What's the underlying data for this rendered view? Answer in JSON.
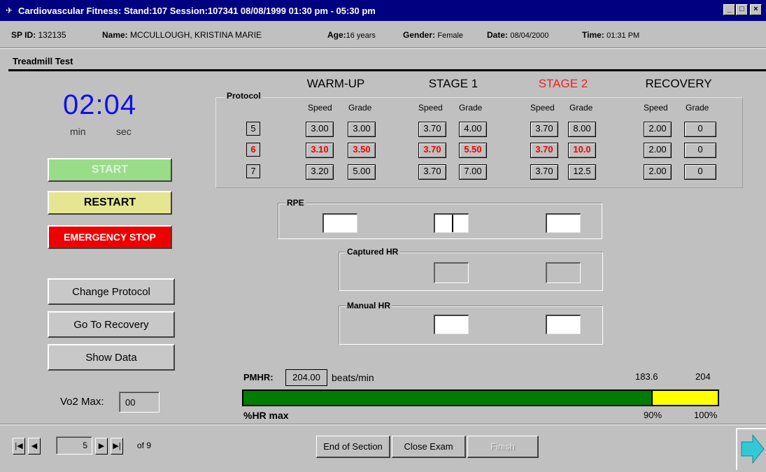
{
  "window": {
    "title": "Cardiovascular Fitness: Stand:107 Session:107341 08/08/1999 01:30 pm - 05:30 pm",
    "controls": [
      "_",
      "□",
      "×"
    ]
  },
  "info": {
    "spid_label": "SP ID:",
    "spid_value": "132135",
    "name_label": "Name:",
    "name_value": "MCCULLOUGH, KRISTINA MARIE",
    "age_label": "Age:",
    "age_value": "16 years",
    "gender_label": "Gender:",
    "gender_value": "Female",
    "date_label": "Date:",
    "date_value": "08/04/2000",
    "time_label": "Time:",
    "time_value": "01:31 PM"
  },
  "section_title": "Treadmill Test",
  "timer": {
    "display": "02:04",
    "min_label": "min",
    "sec_label": "sec"
  },
  "buttons": {
    "start": "START",
    "restart": "RESTART",
    "emergency": "EMERGENCY STOP",
    "change_protocol": "Change Protocol",
    "go_to_recovery": "Go To Recovery",
    "show_data": "Show Data"
  },
  "vo2": {
    "label": "Vo2 Max:",
    "value": "00"
  },
  "protocol": {
    "label": "Protocol",
    "stages": [
      "WARM-UP",
      "STAGE 1",
      "STAGE 2",
      "RECOVERY"
    ],
    "current_stage_color": "#ee2222",
    "speed_label": "Speed",
    "grade_label": "Grade",
    "rows": [
      {
        "id": "5",
        "values": [
          "3.00",
          "3.00",
          "3.70",
          "4.00",
          "3.70",
          "8.00",
          "2.00",
          "0"
        ]
      },
      {
        "id": "6",
        "values": [
          "3.10",
          "3.50",
          "3.70",
          "5.50",
          "3.70",
          "10.0",
          "2.00",
          "0"
        ]
      },
      {
        "id": "7",
        "values": [
          "3.20",
          "5.00",
          "3.70",
          "7.00",
          "3.70",
          "12.5",
          "2.00",
          "0"
        ]
      }
    ]
  },
  "rpe": {
    "label": "RPE"
  },
  "captured_hr": {
    "label": "Captured HR"
  },
  "manual_hr": {
    "label": "Manual HR"
  },
  "pmhr": {
    "label": "PMHR:",
    "value": "204.00",
    "unit": "beats/min",
    "val_90": "183.6",
    "val_100": "204",
    "bar_label": "%HR max",
    "pct_90": "90%",
    "pct_100": "100%",
    "green_fraction": 0.86,
    "yellow_fraction": 0.14,
    "green_color": "#007d00",
    "yellow_color": "#ffff00"
  },
  "footer": {
    "record_value": "5",
    "record_of": "of 9",
    "end_of_section": "End of Section",
    "close_exam": "Close Exam",
    "finish": "Finish"
  }
}
